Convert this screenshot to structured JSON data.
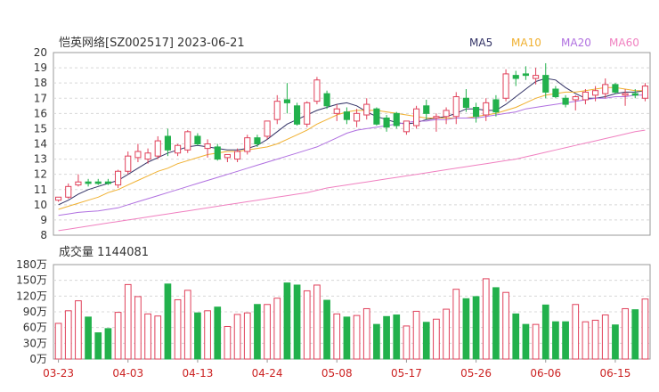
{
  "header": {
    "title": "恺英网络[SZ002517] 2023-06-21"
  },
  "legend": [
    {
      "label": "MA5",
      "color": "#333366"
    },
    {
      "label": "MA10",
      "color": "#f0b030"
    },
    {
      "label": "MA20",
      "color": "#b070e0"
    },
    {
      "label": "MA60",
      "color": "#f080c0"
    }
  ],
  "volume_panel": {
    "title": "成交量 1144081"
  },
  "colors": {
    "up": "#e0405a",
    "down": "#22b14c",
    "grid": "#d8d8d8"
  },
  "chart_data": [
    {
      "type": "candlestick",
      "title": "恺英网络[SZ002517] 2023-06-21",
      "ylim": [
        8,
        20
      ],
      "y_ticks": [
        "20",
        "19",
        "18",
        "17",
        "16",
        "15",
        "14",
        "13",
        "12",
        "11",
        "10",
        "9",
        "8"
      ],
      "x_tick_labels": [
        "03-23",
        "04-03",
        "04-13",
        "04-24",
        "05-08",
        "05-17",
        "05-26",
        "06-06",
        "06-15"
      ],
      "x_tick_index": [
        0,
        7,
        14,
        21,
        28,
        35,
        42,
        49,
        56
      ],
      "candles": [
        {
          "o": 10.3,
          "h": 10.5,
          "l": 10.2,
          "c": 10.5,
          "d": "up"
        },
        {
          "o": 10.5,
          "h": 11.4,
          "l": 10.4,
          "c": 11.2,
          "d": "up"
        },
        {
          "o": 11.3,
          "h": 12.0,
          "l": 11.2,
          "c": 11.5,
          "d": "up"
        },
        {
          "o": 11.5,
          "h": 11.7,
          "l": 11.2,
          "c": 11.4,
          "d": "down"
        },
        {
          "o": 11.5,
          "h": 11.7,
          "l": 11.3,
          "c": 11.4,
          "d": "down"
        },
        {
          "o": 11.5,
          "h": 11.7,
          "l": 11.3,
          "c": 11.4,
          "d": "down"
        },
        {
          "o": 11.3,
          "h": 12.3,
          "l": 11.1,
          "c": 12.2,
          "d": "up"
        },
        {
          "o": 12.2,
          "h": 13.5,
          "l": 12.0,
          "c": 13.2,
          "d": "up"
        },
        {
          "o": 13.1,
          "h": 14.0,
          "l": 12.8,
          "c": 13.5,
          "d": "up"
        },
        {
          "o": 13.0,
          "h": 13.7,
          "l": 12.7,
          "c": 13.4,
          "d": "up"
        },
        {
          "o": 13.2,
          "h": 14.5,
          "l": 13.0,
          "c": 14.2,
          "d": "up"
        },
        {
          "o": 14.5,
          "h": 15.0,
          "l": 13.2,
          "c": 13.6,
          "d": "down"
        },
        {
          "o": 13.4,
          "h": 14.0,
          "l": 13.2,
          "c": 13.9,
          "d": "up"
        },
        {
          "o": 13.6,
          "h": 14.9,
          "l": 13.4,
          "c": 14.8,
          "d": "up"
        },
        {
          "o": 14.5,
          "h": 14.7,
          "l": 13.9,
          "c": 14.0,
          "d": "down"
        },
        {
          "o": 14.0,
          "h": 14.3,
          "l": 13.1,
          "c": 13.7,
          "d": "up"
        },
        {
          "o": 13.8,
          "h": 14.0,
          "l": 12.9,
          "c": 13.0,
          "d": "down"
        },
        {
          "o": 13.1,
          "h": 13.3,
          "l": 12.8,
          "c": 13.3,
          "d": "up"
        },
        {
          "o": 13.0,
          "h": 13.7,
          "l": 12.8,
          "c": 13.5,
          "d": "up"
        },
        {
          "o": 13.5,
          "h": 14.6,
          "l": 13.3,
          "c": 14.4,
          "d": "up"
        },
        {
          "o": 14.4,
          "h": 14.6,
          "l": 13.8,
          "c": 14.0,
          "d": "down"
        },
        {
          "o": 14.5,
          "h": 15.5,
          "l": 14.3,
          "c": 15.5,
          "d": "up"
        },
        {
          "o": 15.6,
          "h": 17.2,
          "l": 15.3,
          "c": 16.8,
          "d": "up"
        },
        {
          "o": 16.9,
          "h": 18.0,
          "l": 16.0,
          "c": 16.7,
          "d": "down"
        },
        {
          "o": 16.5,
          "h": 16.7,
          "l": 15.2,
          "c": 15.3,
          "d": "down"
        },
        {
          "o": 15.3,
          "h": 16.8,
          "l": 15.1,
          "c": 16.7,
          "d": "up"
        },
        {
          "o": 16.8,
          "h": 18.4,
          "l": 16.6,
          "c": 18.2,
          "d": "up"
        },
        {
          "o": 17.3,
          "h": 17.5,
          "l": 16.3,
          "c": 16.5,
          "d": "down"
        },
        {
          "o": 16.0,
          "h": 16.6,
          "l": 15.5,
          "c": 16.3,
          "d": "up"
        },
        {
          "o": 16.1,
          "h": 16.4,
          "l": 15.3,
          "c": 15.6,
          "d": "down"
        },
        {
          "o": 15.5,
          "h": 16.3,
          "l": 15.1,
          "c": 16.0,
          "d": "up"
        },
        {
          "o": 15.9,
          "h": 17.0,
          "l": 15.6,
          "c": 16.6,
          "d": "up"
        },
        {
          "o": 16.3,
          "h": 16.4,
          "l": 15.2,
          "c": 15.3,
          "d": "down"
        },
        {
          "o": 15.7,
          "h": 15.9,
          "l": 14.8,
          "c": 15.1,
          "d": "down"
        },
        {
          "o": 16.0,
          "h": 16.1,
          "l": 15.0,
          "c": 15.2,
          "d": "down"
        },
        {
          "o": 14.8,
          "h": 15.5,
          "l": 14.6,
          "c": 15.5,
          "d": "up"
        },
        {
          "o": 15.2,
          "h": 16.5,
          "l": 15.0,
          "c": 16.3,
          "d": "up"
        },
        {
          "o": 16.5,
          "h": 16.9,
          "l": 15.6,
          "c": 16.0,
          "d": "down"
        },
        {
          "o": 15.7,
          "h": 16.0,
          "l": 14.8,
          "c": 15.8,
          "d": "up"
        },
        {
          "o": 15.8,
          "h": 16.4,
          "l": 15.3,
          "c": 16.2,
          "d": "up"
        },
        {
          "o": 15.8,
          "h": 17.4,
          "l": 15.3,
          "c": 17.1,
          "d": "up"
        },
        {
          "o": 17.0,
          "h": 17.6,
          "l": 16.1,
          "c": 16.4,
          "d": "down"
        },
        {
          "o": 16.4,
          "h": 16.7,
          "l": 15.4,
          "c": 15.8,
          "d": "down"
        },
        {
          "o": 15.9,
          "h": 17.0,
          "l": 15.5,
          "c": 16.7,
          "d": "up"
        },
        {
          "o": 16.9,
          "h": 17.2,
          "l": 15.8,
          "c": 16.1,
          "d": "down"
        },
        {
          "o": 17.0,
          "h": 18.9,
          "l": 16.8,
          "c": 18.6,
          "d": "up"
        },
        {
          "o": 18.5,
          "h": 18.8,
          "l": 17.8,
          "c": 18.3,
          "d": "down"
        },
        {
          "o": 18.6,
          "h": 19.1,
          "l": 18.2,
          "c": 18.5,
          "d": "down"
        },
        {
          "o": 18.3,
          "h": 19.0,
          "l": 17.9,
          "c": 18.5,
          "d": "up"
        },
        {
          "o": 18.5,
          "h": 19.3,
          "l": 17.0,
          "c": 17.4,
          "d": "down"
        },
        {
          "o": 17.6,
          "h": 17.8,
          "l": 17.0,
          "c": 17.1,
          "d": "down"
        },
        {
          "o": 17.0,
          "h": 17.2,
          "l": 16.4,
          "c": 16.6,
          "d": "down"
        },
        {
          "o": 16.9,
          "h": 17.2,
          "l": 16.2,
          "c": 17.1,
          "d": "up"
        },
        {
          "o": 16.9,
          "h": 17.6,
          "l": 16.6,
          "c": 17.4,
          "d": "up"
        },
        {
          "o": 17.2,
          "h": 17.8,
          "l": 16.8,
          "c": 17.5,
          "d": "up"
        },
        {
          "o": 17.3,
          "h": 18.3,
          "l": 17.0,
          "c": 17.9,
          "d": "up"
        },
        {
          "o": 17.9,
          "h": 18.0,
          "l": 17.3,
          "c": 17.4,
          "d": "down"
        },
        {
          "o": 17.2,
          "h": 17.6,
          "l": 16.5,
          "c": 17.3,
          "d": "up"
        },
        {
          "o": 17.3,
          "h": 17.6,
          "l": 17.0,
          "c": 17.2,
          "d": "down"
        },
        {
          "o": 17.0,
          "h": 18.0,
          "l": 16.8,
          "c": 17.8,
          "d": "up"
        }
      ],
      "series": [
        {
          "name": "MA5",
          "values": [
            10.0,
            10.3,
            10.7,
            11.0,
            11.2,
            11.4,
            11.6,
            12.0,
            12.4,
            12.8,
            13.1,
            13.4,
            13.6,
            13.8,
            13.9,
            13.8,
            13.7,
            13.6,
            13.6,
            13.7,
            13.9,
            14.3,
            14.8,
            15.3,
            15.6,
            15.9,
            16.2,
            16.4,
            16.6,
            16.7,
            16.5,
            16.1,
            15.8,
            15.6,
            15.4,
            15.3,
            15.4,
            15.6,
            15.7,
            15.8,
            16.0,
            16.3,
            16.3,
            16.2,
            16.2,
            16.6,
            17.1,
            17.6,
            18.1,
            18.3,
            18.2,
            17.7,
            17.3,
            17.0,
            17.0,
            17.1,
            17.3,
            17.4,
            17.4,
            17.5
          ]
        },
        {
          "name": "MA10",
          "values": [
            9.7,
            9.9,
            10.1,
            10.3,
            10.5,
            10.8,
            11.0,
            11.3,
            11.6,
            11.9,
            12.2,
            12.4,
            12.7,
            12.9,
            13.1,
            13.3,
            13.4,
            13.5,
            13.5,
            13.6,
            13.7,
            13.8,
            14.0,
            14.3,
            14.6,
            14.9,
            15.3,
            15.6,
            15.9,
            16.1,
            16.2,
            16.2,
            16.2,
            16.1,
            16.0,
            15.9,
            15.8,
            15.7,
            15.7,
            15.7,
            15.7,
            15.7,
            15.8,
            15.9,
            16.0,
            16.2,
            16.4,
            16.7,
            17.0,
            17.2,
            17.3,
            17.4,
            17.4,
            17.5,
            17.6,
            17.7,
            17.7,
            17.6,
            17.5,
            17.5
          ]
        },
        {
          "name": "MA20",
          "values": [
            9.3,
            9.4,
            9.5,
            9.55,
            9.6,
            9.7,
            9.8,
            10.0,
            10.2,
            10.4,
            10.6,
            10.8,
            11.0,
            11.2,
            11.4,
            11.6,
            11.8,
            12.0,
            12.2,
            12.4,
            12.6,
            12.8,
            13.0,
            13.2,
            13.4,
            13.6,
            13.8,
            14.1,
            14.4,
            14.7,
            14.9,
            15.0,
            15.1,
            15.2,
            15.3,
            15.4,
            15.5,
            15.5,
            15.6,
            15.6,
            15.7,
            15.7,
            15.7,
            15.8,
            15.9,
            16.0,
            16.1,
            16.3,
            16.4,
            16.5,
            16.6,
            16.7,
            16.8,
            16.9,
            17.0,
            17.0,
            17.1,
            17.1,
            17.2,
            17.2
          ]
        },
        {
          "name": "MA60",
          "values": [
            8.3,
            8.4,
            8.5,
            8.6,
            8.7,
            8.8,
            8.9,
            9.0,
            9.1,
            9.2,
            9.3,
            9.4,
            9.5,
            9.6,
            9.7,
            9.8,
            9.9,
            10.0,
            10.1,
            10.2,
            10.3,
            10.4,
            10.5,
            10.6,
            10.7,
            10.8,
            10.95,
            11.1,
            11.2,
            11.3,
            11.4,
            11.5,
            11.6,
            11.7,
            11.8,
            11.9,
            12.0,
            12.1,
            12.2,
            12.3,
            12.4,
            12.5,
            12.6,
            12.7,
            12.8,
            12.9,
            13.0,
            13.15,
            13.3,
            13.45,
            13.6,
            13.75,
            13.9,
            14.05,
            14.2,
            14.35,
            14.5,
            14.65,
            14.8,
            14.9
          ]
        }
      ]
    },
    {
      "type": "bar",
      "title": "成交量 1144081",
      "ylim": [
        0,
        1800000
      ],
      "y_ticks": [
        "180万",
        "150万",
        "120万",
        "90万",
        "60万",
        "30万",
        "0万"
      ],
      "values": [
        {
          "v": 680000,
          "d": "up"
        },
        {
          "v": 920000,
          "d": "up"
        },
        {
          "v": 1110000,
          "d": "up"
        },
        {
          "v": 800000,
          "d": "down"
        },
        {
          "v": 500000,
          "d": "down"
        },
        {
          "v": 580000,
          "d": "down"
        },
        {
          "v": 890000,
          "d": "up"
        },
        {
          "v": 1420000,
          "d": "up"
        },
        {
          "v": 1190000,
          "d": "up"
        },
        {
          "v": 860000,
          "d": "up"
        },
        {
          "v": 820000,
          "d": "up"
        },
        {
          "v": 1430000,
          "d": "down"
        },
        {
          "v": 1130000,
          "d": "up"
        },
        {
          "v": 1310000,
          "d": "up"
        },
        {
          "v": 880000,
          "d": "down"
        },
        {
          "v": 920000,
          "d": "up"
        },
        {
          "v": 990000,
          "d": "down"
        },
        {
          "v": 620000,
          "d": "up"
        },
        {
          "v": 850000,
          "d": "up"
        },
        {
          "v": 880000,
          "d": "up"
        },
        {
          "v": 1040000,
          "d": "down"
        },
        {
          "v": 1040000,
          "d": "up"
        },
        {
          "v": 1160000,
          "d": "up"
        },
        {
          "v": 1450000,
          "d": "down"
        },
        {
          "v": 1410000,
          "d": "down"
        },
        {
          "v": 1300000,
          "d": "up"
        },
        {
          "v": 1410000,
          "d": "up"
        },
        {
          "v": 1120000,
          "d": "down"
        },
        {
          "v": 860000,
          "d": "up"
        },
        {
          "v": 800000,
          "d": "down"
        },
        {
          "v": 830000,
          "d": "up"
        },
        {
          "v": 960000,
          "d": "up"
        },
        {
          "v": 660000,
          "d": "down"
        },
        {
          "v": 810000,
          "d": "down"
        },
        {
          "v": 840000,
          "d": "down"
        },
        {
          "v": 630000,
          "d": "up"
        },
        {
          "v": 910000,
          "d": "up"
        },
        {
          "v": 700000,
          "d": "down"
        },
        {
          "v": 760000,
          "d": "up"
        },
        {
          "v": 950000,
          "d": "up"
        },
        {
          "v": 1330000,
          "d": "up"
        },
        {
          "v": 1150000,
          "d": "down"
        },
        {
          "v": 1190000,
          "d": "down"
        },
        {
          "v": 1530000,
          "d": "up"
        },
        {
          "v": 1360000,
          "d": "down"
        },
        {
          "v": 1270000,
          "d": "up"
        },
        {
          "v": 860000,
          "d": "down"
        },
        {
          "v": 660000,
          "d": "down"
        },
        {
          "v": 660000,
          "d": "up"
        },
        {
          "v": 1030000,
          "d": "down"
        },
        {
          "v": 710000,
          "d": "down"
        },
        {
          "v": 710000,
          "d": "down"
        },
        {
          "v": 1040000,
          "d": "up"
        },
        {
          "v": 710000,
          "d": "up"
        },
        {
          "v": 740000,
          "d": "up"
        },
        {
          "v": 840000,
          "d": "up"
        },
        {
          "v": 650000,
          "d": "down"
        },
        {
          "v": 960000,
          "d": "up"
        },
        {
          "v": 940000,
          "d": "down"
        },
        {
          "v": 1144081,
          "d": "up"
        }
      ]
    }
  ]
}
